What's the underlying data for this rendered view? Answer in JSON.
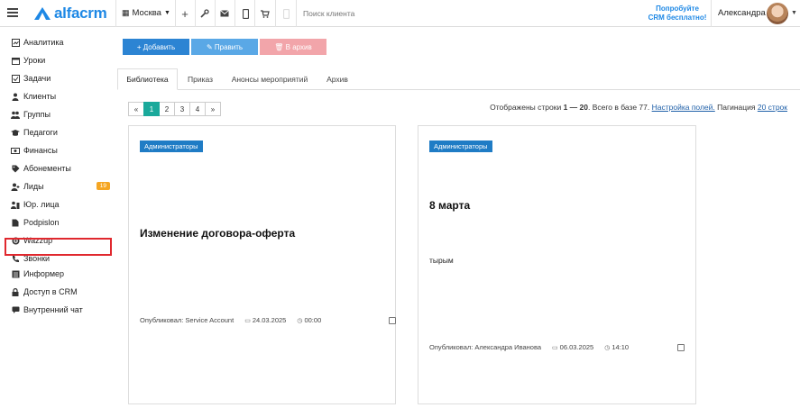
{
  "header": {
    "logo_text": "alfacrm",
    "city": "Москва",
    "search_placeholder": "Поиск клиента",
    "promo_line1": "Попробуйте",
    "promo_line2": "CRM бесплатно!",
    "user_name": "Александра"
  },
  "sidebar": {
    "items": [
      {
        "label": "Аналитика",
        "icon": "analytics-icon"
      },
      {
        "label": "Уроки",
        "icon": "calendar-icon"
      },
      {
        "label": "Задачи",
        "icon": "tasks-icon"
      },
      {
        "label": "Клиенты",
        "icon": "client-icon"
      },
      {
        "label": "Группы",
        "icon": "group-icon"
      },
      {
        "label": "Педагоги",
        "icon": "teacher-icon"
      },
      {
        "label": "Финансы",
        "icon": "money-icon"
      },
      {
        "label": "Абонементы",
        "icon": "tag-icon"
      },
      {
        "label": "Лиды",
        "icon": "lead-icon",
        "badge": "19"
      },
      {
        "label": "Юр. лица",
        "icon": "building-icon"
      },
      {
        "label": "Podpislon",
        "icon": "document-icon"
      },
      {
        "label": "Wazzup",
        "icon": "whatsapp-icon"
      },
      {
        "label": "Звонки",
        "icon": "phone-icon"
      },
      {
        "label": "Информер",
        "icon": "list-icon"
      },
      {
        "label": "Доступ в CRM",
        "icon": "lock-icon"
      },
      {
        "label": "Внутренний чат",
        "icon": "chat-icon"
      }
    ]
  },
  "toolbar": {
    "add_label": "+ Добавить",
    "edit_label": "✎ Править",
    "archive_label": "🗑 В архив"
  },
  "tabs": [
    "Библиотека",
    "Приказ",
    "Анонсы мероприятий",
    "Архив"
  ],
  "pagination": {
    "pages": [
      "«",
      "1",
      "2",
      "3",
      "4",
      "»"
    ],
    "active": "1",
    "info_prefix": "Отображены строки",
    "range": "1 — 20",
    "info_mid": ". Всего в базе 77.",
    "settings_link": "Настройка полей.",
    "pagination_label": "Пагинация",
    "per_page_link": "20 строк"
  },
  "cards": [
    {
      "tag": "Администраторы",
      "title": "Изменение договора-оферта",
      "text": "",
      "author": "Опубликовал: Service Account",
      "date": "24.03.2025",
      "time": "00:00"
    },
    {
      "tag": "Администраторы",
      "title": "8 марта",
      "text": "тырым",
      "author": "Опубликовал: Александра Иванова",
      "date": "06.03.2025",
      "time": "14:10"
    }
  ],
  "colors": {
    "brand": "#1e88e5",
    "add_button": "#2c84d3",
    "edit_button": "#5aa8e6",
    "archive_button": "#f2a5aa",
    "active_page": "#1aa99b",
    "tag": "#1f7cc5",
    "highlight": "#e0282e",
    "lead_badge": "#f5a623"
  }
}
